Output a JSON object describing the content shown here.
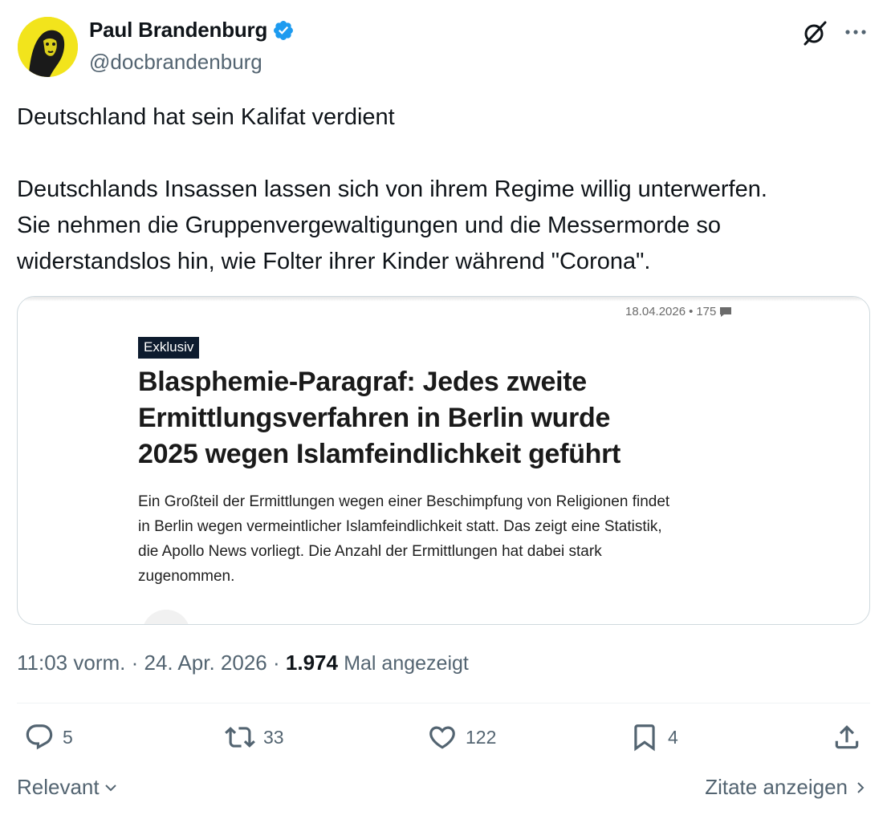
{
  "author": {
    "display_name": "Paul Brandenburg",
    "handle": "@docbrandenburg",
    "verified": true,
    "avatar_color": "#f2e41c"
  },
  "tweet": {
    "text_lines": [
      "Deutschland hat sein Kalifat verdient",
      "",
      "Deutschlands Insassen lassen sich von ihrem Regime willig unterwerfen.",
      "Sie nehmen die Gruppenvergewaltigungen und die Messermorde so",
      "widerstandslos hin, wie Folter ihrer Kinder während \"Corona\"."
    ]
  },
  "card": {
    "meta_date": "18.04.2026",
    "meta_separator": "•",
    "meta_comments": "175",
    "badge": "Exklusiv",
    "headline_lines": [
      "Blasphemie-Paragraf: Jedes zweite",
      "Ermittlungsverfahren in Berlin wurde",
      "2025 wegen Islamfeindlichkeit geführt"
    ],
    "lead_lines": [
      "Ein Großteil der Ermittlungen wegen einer Beschimpfung von Religionen findet",
      "in Berlin wegen vermeintlicher Islamfeindlichkeit statt. Das zeigt eine Statistik,",
      "die Apollo News vorliegt. Die Anzahl der Ermittlungen hat dabei stark",
      "zugenommen."
    ]
  },
  "meta": {
    "time": "11:03 vorm.",
    "separator": "·",
    "date": "24. Apr. 2026",
    "views_count": "1.974",
    "views_label": "Mal angezeigt"
  },
  "actions": {
    "replies": "5",
    "reposts": "33",
    "likes": "122",
    "bookmarks": "4"
  },
  "footer": {
    "sort_label": "Relevant",
    "quotes_label": "Zitate anzeigen"
  },
  "colors": {
    "text_primary": "#0f1419",
    "text_secondary": "#536471",
    "verified_blue": "#1d9bf0",
    "border": "#cfd9de",
    "badge_bg": "#0d1b2e"
  }
}
